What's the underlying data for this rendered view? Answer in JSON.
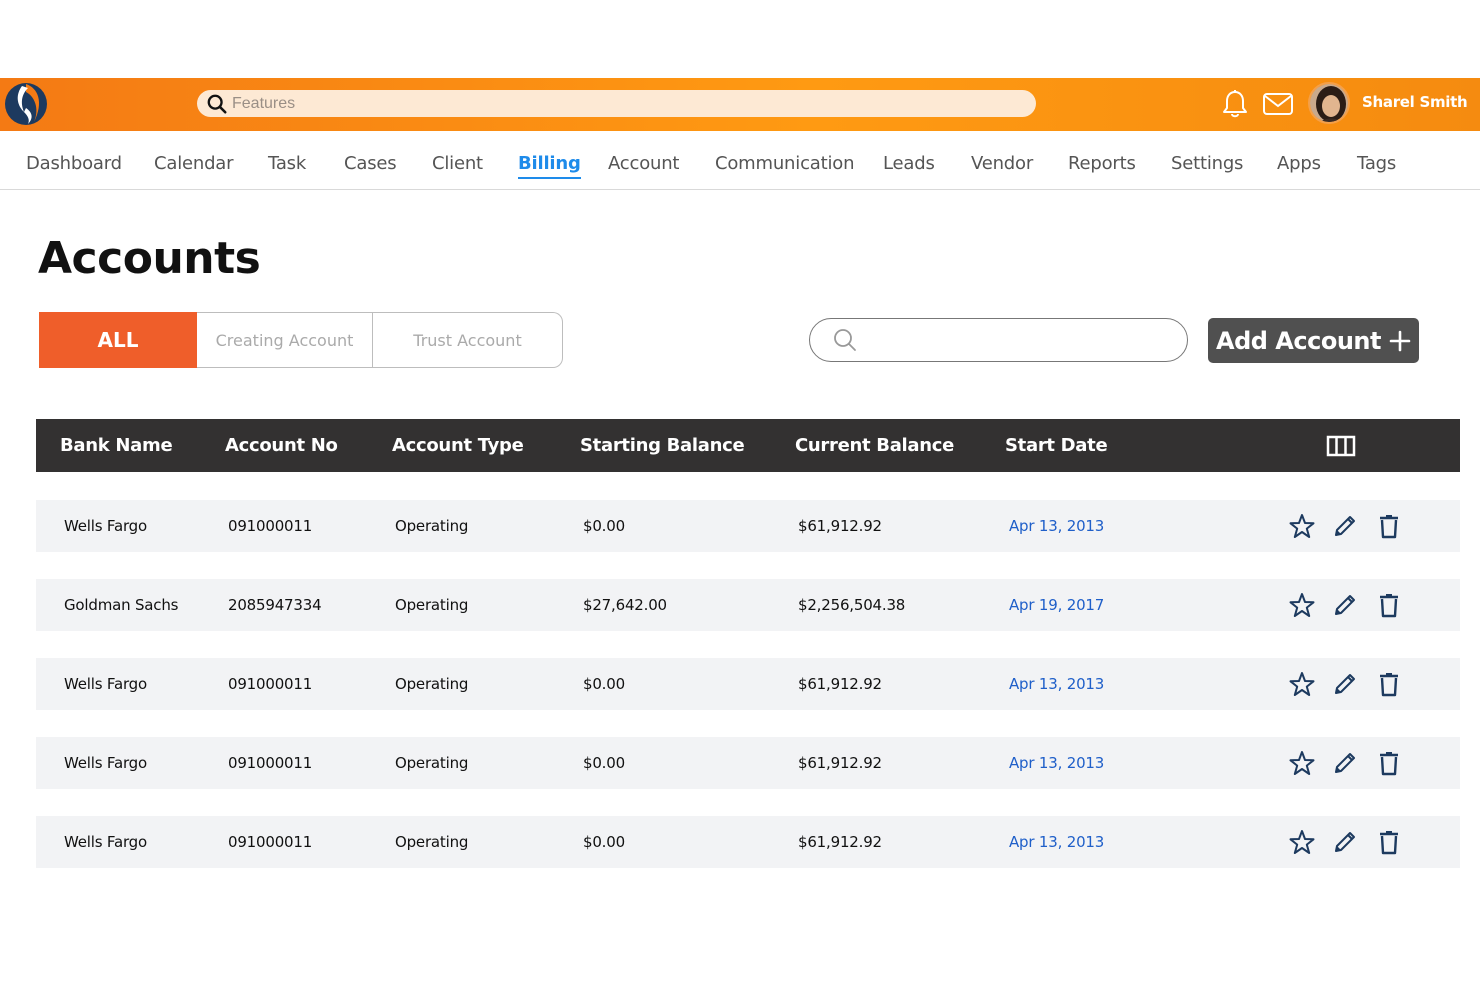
{
  "header": {
    "search_placeholder": "Features",
    "user_name": "Sharel Smith"
  },
  "nav": {
    "items": [
      {
        "label": "Dashboard"
      },
      {
        "label": "Calendar"
      },
      {
        "label": "Task"
      },
      {
        "label": "Cases"
      },
      {
        "label": "Client"
      },
      {
        "label": "Billing",
        "active": true
      },
      {
        "label": "Account"
      },
      {
        "label": "Communication"
      },
      {
        "label": "Leads"
      },
      {
        "label": "Vendor"
      },
      {
        "label": "Reports"
      },
      {
        "label": "Settings"
      },
      {
        "label": "Apps"
      },
      {
        "label": "Tags"
      }
    ]
  },
  "page": {
    "title": "Accounts",
    "tabs": [
      {
        "label": "ALL",
        "active": true
      },
      {
        "label": "Creating Account"
      },
      {
        "label": "Trust Account"
      }
    ],
    "search_placeholder": "",
    "add_button_label": "Add Account",
    "add_button_icon": "plus-icon"
  },
  "table": {
    "columns": [
      "Bank Name",
      "Account No",
      "Account Type",
      "Starting Balance",
      "Current Balance",
      "Start Date"
    ],
    "columns_icon": "columns-icon",
    "rows": [
      {
        "bank": "Wells Fargo",
        "account_no": "091000011",
        "type": "Operating",
        "starting": "$0.00",
        "current": "$61,912.92",
        "date": "Apr 13, 2013"
      },
      {
        "bank": "Goldman Sachs",
        "account_no": "2085947334",
        "type": "Operating",
        "starting": "$27,642.00",
        "current": "$2,256,504.38",
        "date": "Apr 19, 2017"
      },
      {
        "bank": "Wells Fargo",
        "account_no": "091000011",
        "type": "Operating",
        "starting": "$0.00",
        "current": "$61,912.92",
        "date": "Apr 13, 2013"
      },
      {
        "bank": "Wells Fargo",
        "account_no": "091000011",
        "type": "Operating",
        "starting": "$0.00",
        "current": "$61,912.92",
        "date": "Apr 13, 2013"
      },
      {
        "bank": "Wells Fargo",
        "account_no": "091000011",
        "type": "Operating",
        "starting": "$0.00",
        "current": "$61,912.92",
        "date": "Apr 13, 2013"
      }
    ],
    "row_actions": [
      "star-icon",
      "pencil-icon",
      "trash-icon"
    ]
  },
  "colors": {
    "brand_orange": "#f47a14",
    "tab_active": "#ef5e2a",
    "link_blue": "#1e8bea",
    "date_blue": "#1f5fc9",
    "header_dark": "#333131"
  }
}
